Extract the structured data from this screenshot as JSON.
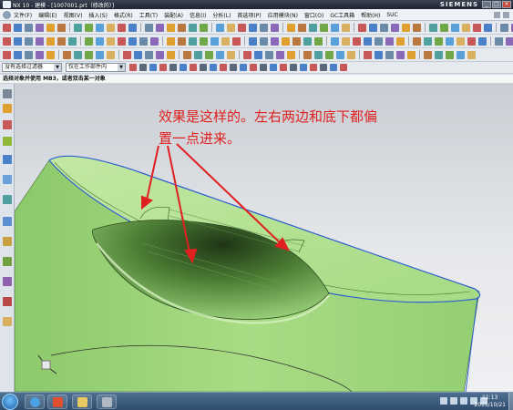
{
  "titlebar": {
    "title": "NX 10 - 建模 - [1007001.prt（修改的）]",
    "brand": "SIEMENS"
  },
  "menu": {
    "items": [
      "文件(F)",
      "编辑(E)",
      "视图(V)",
      "插入(S)",
      "格式(R)",
      "工具(T)",
      "装配(A)",
      "信息(I)",
      "分析(L)",
      "首选项(P)",
      "应用模块(N)",
      "窗口(O)",
      "GC工具箱",
      "帮助(H)",
      "SUC"
    ]
  },
  "filter": {
    "type_filter": "没有选择过滤器",
    "scope_filter": "仅在工作部件内"
  },
  "cue": {
    "text": "选择对象并使用 MB3，或者双击某一对象"
  },
  "annotation": {
    "line1": "效果是这样的。左右两边和底下都偏",
    "line2": "置一点进来。"
  },
  "clock": {
    "time": "11:13",
    "date": "2015/10/21"
  },
  "colors": {
    "annotation": "#e02020",
    "part_green": "#8fcf6e",
    "edge_blue": "#3a5fd0"
  }
}
